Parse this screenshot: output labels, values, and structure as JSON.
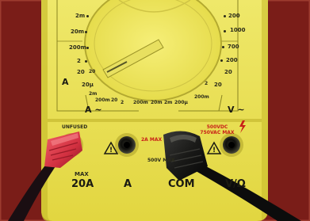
{
  "dial_ranges_left": [
    "2m",
    "20m",
    "200m",
    "2",
    "20",
    "20µ",
    "2m",
    "200m",
    "20"
  ],
  "dial_ranges_right": [
    "200",
    "1000",
    "700",
    "200",
    "20",
    "20"
  ],
  "dial_ranges_bottom_left": [
    "200µ",
    "20",
    "200m",
    "2",
    "20m",
    "200m",
    "2m",
    "200µ"
  ],
  "dial_ranges_bottom_right": [
    "2",
    "200m"
  ],
  "ac_current_label": "A ~",
  "dc_current_label": "A",
  "ac_voltage_label": "V ~",
  "jack_20a_top_label": "UNFUSED",
  "jack_20a_max_label": "MAX",
  "jack_20a_label": "20A",
  "jack_a_label": "A",
  "jack_com_label": "COM",
  "jack_com_rating": "500V MAX",
  "jack_com_warning": "2A MAX",
  "jack_vohm_warning": "500VDC 750VAC MAX",
  "jack_vohm_label": "V/Ω"
}
